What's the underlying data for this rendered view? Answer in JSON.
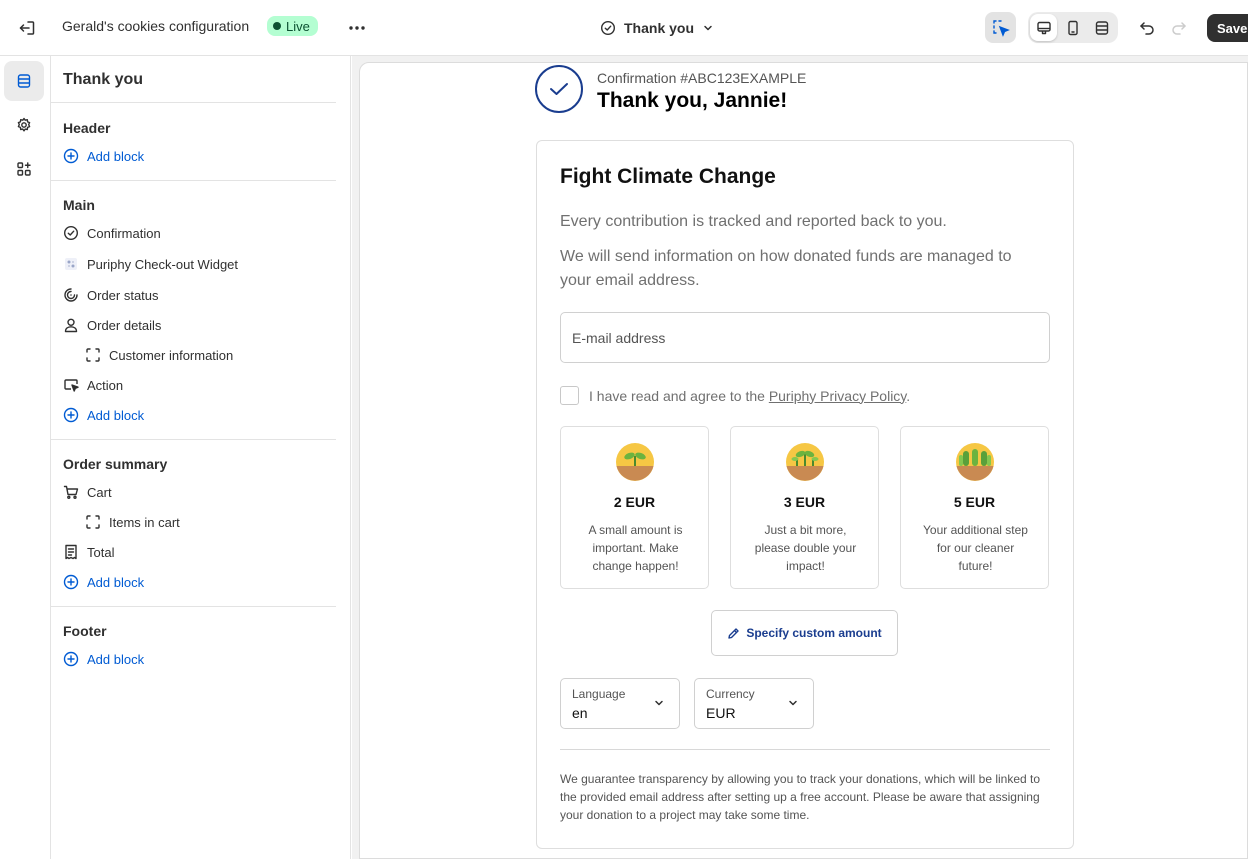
{
  "topbar": {
    "title": "Gerald's cookies configuration",
    "status": "Live",
    "page": "Thank you",
    "save_label": "Save"
  },
  "sidebar": {
    "title": "Thank you",
    "sections": [
      {
        "heading": "Header",
        "add_label": "Add block"
      },
      {
        "heading": "Main",
        "items": [
          "Confirmation",
          "Puriphy Check-out Widget",
          "Order status",
          "Order details",
          "Customer information",
          "Action"
        ],
        "add_label": "Add block"
      },
      {
        "heading": "Order summary",
        "items": [
          "Cart",
          "Items in cart",
          "Total"
        ],
        "add_label": "Add block"
      },
      {
        "heading": "Footer",
        "add_label": "Add block"
      }
    ]
  },
  "preview": {
    "confirmation_number": "Confirmation #ABC123EXAMPLE",
    "thank_you": "Thank you, Jannie!",
    "widget": {
      "title": "Fight Climate Change",
      "intro": "Every contribution is tracked and reported back to you.",
      "info": "We will send information on how donated funds are managed to your email address.",
      "email_placeholder": "E-mail address",
      "agree_prefix": "I have read and agree to the ",
      "agree_link": "Puriphy Privacy Policy",
      "agree_suffix": ".",
      "tiers": [
        {
          "amount": "2 EUR",
          "description": "A small amount is important. Make change happen!"
        },
        {
          "amount": "3 EUR",
          "description": "Just a bit more, please double your impact!"
        },
        {
          "amount": "5 EUR",
          "description": "Your additional step for our cleaner future!"
        }
      ],
      "custom_amount_label": "Specify custom amount",
      "language": {
        "label": "Language",
        "value": "en"
      },
      "currency": {
        "label": "Currency",
        "value": "EUR"
      },
      "footer_note": "We guarantee transparency by allowing you to track your donations, which will be linked to the provided email address after setting up a free account. Please be aware that assigning your donation to a project may take some time."
    }
  },
  "colors": {
    "accent_blue": "#005bd3",
    "live_badge_bg": "#b4fed2",
    "live_badge_text": "#0c5132",
    "widget_accent": "#1a3d8f"
  }
}
